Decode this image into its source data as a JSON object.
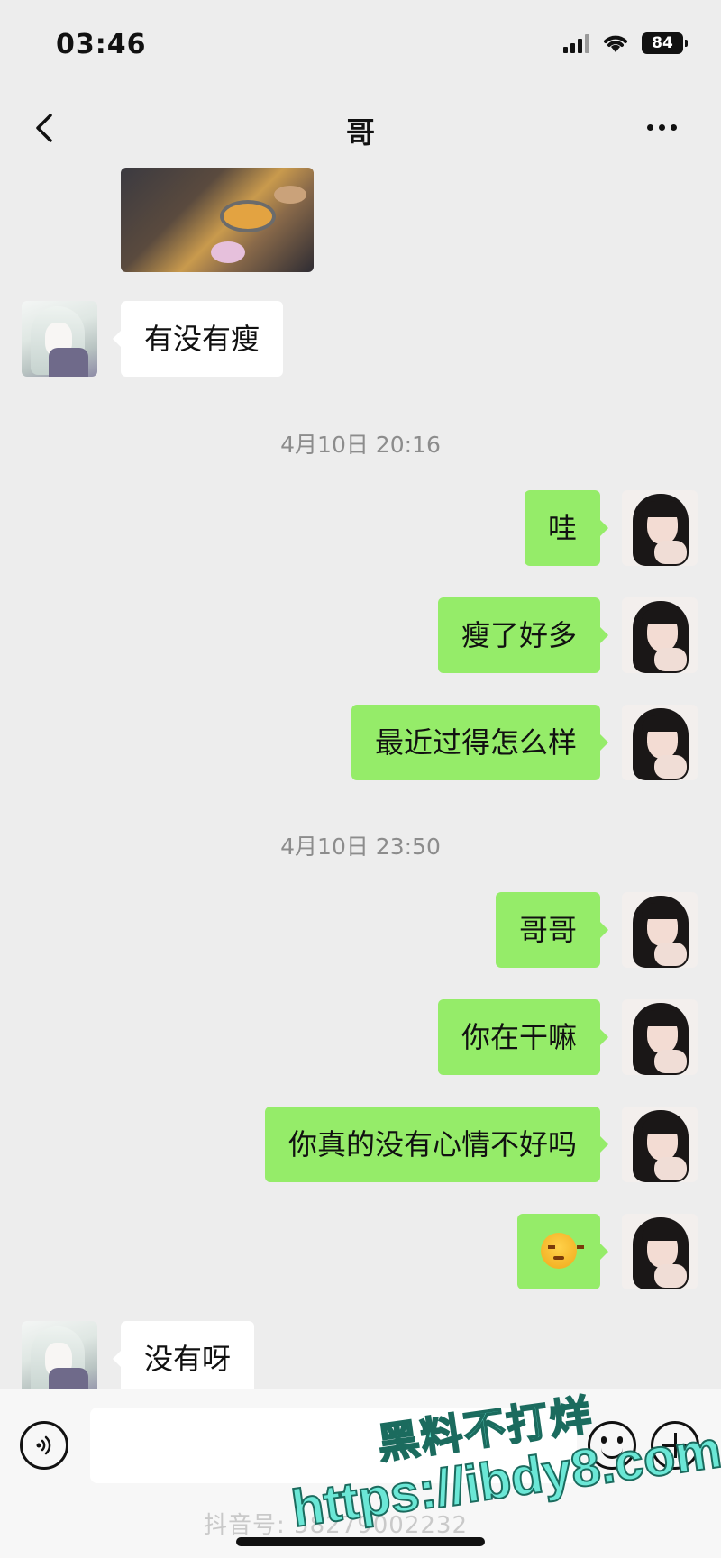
{
  "status_bar": {
    "time": "03:46",
    "battery": "84"
  },
  "header": {
    "title": "哥"
  },
  "messages": {
    "m1": {
      "side": "left",
      "text": "有没有瘦"
    },
    "ts1": "4月10日 20:16",
    "m2": {
      "side": "right",
      "text": "哇"
    },
    "m3": {
      "side": "right",
      "text": "瘦了好多"
    },
    "m4": {
      "side": "right",
      "text": "最近过得怎么样"
    },
    "ts2": "4月10日 23:50",
    "m5": {
      "side": "right",
      "text": "哥哥"
    },
    "m6": {
      "side": "right",
      "text": "你在干嘛"
    },
    "m7": {
      "side": "right",
      "text": "你真的没有心情不好吗"
    },
    "m8": {
      "side": "right",
      "emoji": "angry-face-icon"
    },
    "m9": {
      "side": "left",
      "text": "没有呀"
    }
  },
  "input_bar": {
    "placeholder": ""
  },
  "overlay": {
    "watermark_cn": "黑料不打烊",
    "watermark_url": "https://ibdy8.com",
    "douyin_label": "抖音号: 58279002232"
  },
  "colors": {
    "background": "#ededed",
    "sent_bubble": "#95ec69",
    "received_bubble": "#ffffff",
    "timestamp": "#8c8c8c"
  }
}
